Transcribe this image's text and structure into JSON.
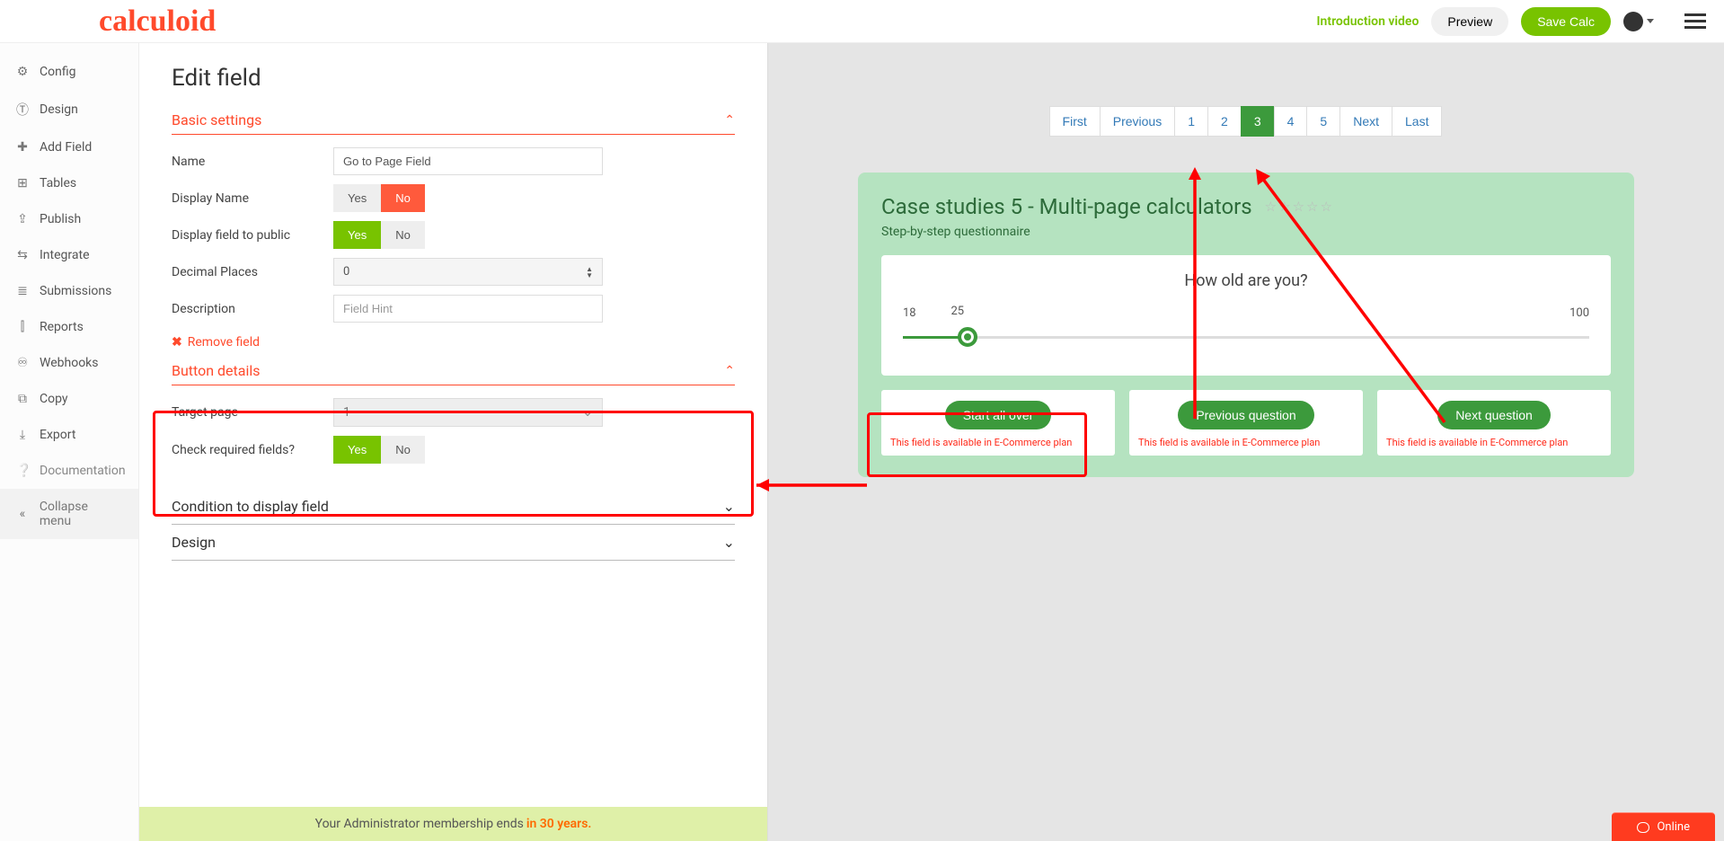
{
  "header": {
    "logo": "calculoid",
    "intro_link": "Introduction video",
    "preview_btn": "Preview",
    "save_btn": "Save Calc"
  },
  "sidebar": {
    "items": [
      {
        "icon": "⚙",
        "label": "Config"
      },
      {
        "icon": "⊤",
        "label": "Design"
      },
      {
        "icon": "➕",
        "label": "Add Field"
      },
      {
        "icon": "⊞",
        "label": "Tables"
      },
      {
        "icon": "↥",
        "label": "Publish"
      },
      {
        "icon": "⇆",
        "label": "Integrate"
      },
      {
        "icon": "≡",
        "label": "Submissions"
      },
      {
        "icon": "📊",
        "label": "Reports"
      },
      {
        "icon": "⟲",
        "label": "Webhooks"
      },
      {
        "icon": "⧉",
        "label": "Copy"
      },
      {
        "icon": "⇪",
        "label": "Export"
      },
      {
        "icon": "❔",
        "label": "Documentation"
      },
      {
        "icon": "«",
        "label": "Collapse menu"
      }
    ]
  },
  "edit": {
    "title": "Edit field",
    "sections": {
      "basic": "Basic settings",
      "button": "Button details",
      "condition": "Condition to display field",
      "design": "Design"
    },
    "fields": {
      "name_label": "Name",
      "name_value": "Go to Page Field",
      "display_name_label": "Display Name",
      "display_public_label": "Display field to public",
      "decimal_label": "Decimal Places",
      "decimal_value": "0",
      "description_label": "Description",
      "description_placeholder": "Field Hint",
      "remove": "Remove field",
      "target_page_label": "Target page",
      "target_page_value": "1",
      "check_required_label": "Check required fields?",
      "yes": "Yes",
      "no": "No"
    }
  },
  "preview": {
    "pagination": {
      "first": "First",
      "previous": "Previous",
      "p1": "1",
      "p2": "2",
      "p3": "3",
      "p4": "4",
      "p5": "5",
      "next": "Next",
      "last": "Last"
    },
    "calc_title": "Case studies 5 - Multi-page calculators",
    "calc_sub": "Step-by-step questionnaire",
    "question": "How old are you?",
    "slider_min": "18",
    "slider_mid": "25",
    "slider_max": "100",
    "buttons": {
      "start": "Start all over",
      "prev": "Previous question",
      "next": "Next question",
      "note": "This field is available in E-Commerce plan"
    }
  },
  "footer": {
    "text": "Your Administrator membership ends ",
    "years": "in 30 years."
  },
  "online": "Online"
}
